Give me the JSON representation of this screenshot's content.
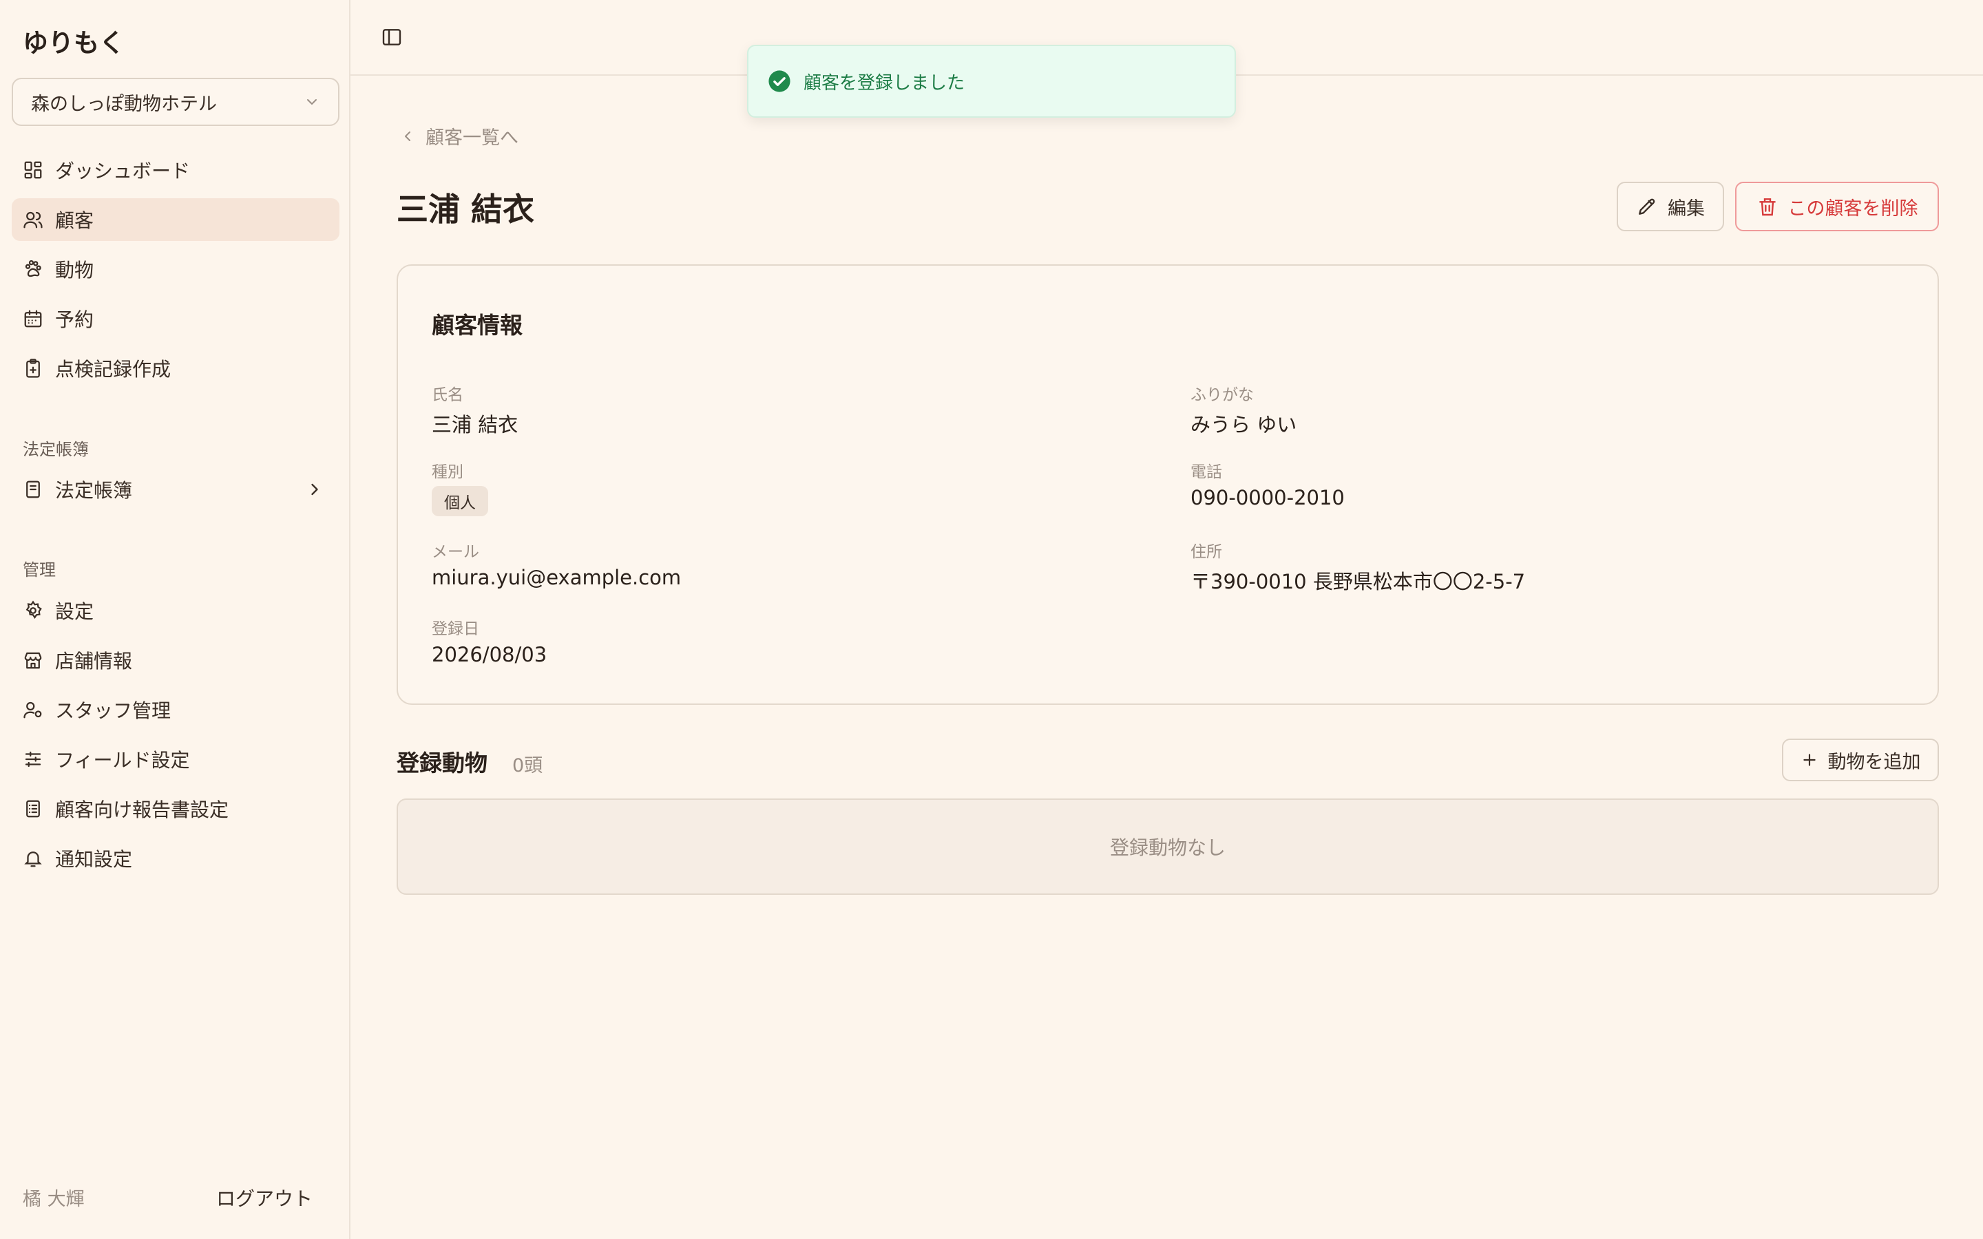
{
  "app": {
    "title": "ゆりもく"
  },
  "store": {
    "selected": "森のしっぽ動物ホテル"
  },
  "sidebar": {
    "main_items": [
      {
        "label": "ダッシュボード",
        "icon": "dashboard-icon"
      },
      {
        "label": "顧客",
        "icon": "users-icon",
        "active": true
      },
      {
        "label": "動物",
        "icon": "paw-icon"
      },
      {
        "label": "予約",
        "icon": "calendar-icon"
      },
      {
        "label": "点検記録作成",
        "icon": "clipboard-plus-icon"
      }
    ],
    "legal_section": "法定帳簿",
    "legal_items": [
      {
        "label": "法定帳簿",
        "icon": "book-icon"
      }
    ],
    "admin_section": "管理",
    "admin_items": [
      {
        "label": "設定",
        "icon": "gear-icon"
      },
      {
        "label": "店舗情報",
        "icon": "store-icon"
      },
      {
        "label": "スタッフ管理",
        "icon": "user-cog-icon"
      },
      {
        "label": "フィールド設定",
        "icon": "sliders-icon"
      },
      {
        "label": "顧客向け報告書設定",
        "icon": "report-icon"
      },
      {
        "label": "通知設定",
        "icon": "bell-icon"
      }
    ],
    "user_name": "橘 大輝",
    "logout_label": "ログアウト"
  },
  "toast": {
    "message": "顧客を登録しました",
    "color": "#1c7c45"
  },
  "breadcrumb": {
    "back_label": "顧客一覧へ"
  },
  "customer": {
    "title": "三浦 結衣",
    "edit_label": "編集",
    "delete_label": "この顧客を削除",
    "card_title": "顧客情報",
    "fields": {
      "name_label": "氏名",
      "name": "三浦 結衣",
      "furigana_label": "ふりがな",
      "furigana": "みうら ゆい",
      "type_label": "種別",
      "type": "個人",
      "phone_label": "電話",
      "phone": "090-0000-2010",
      "email_label": "メール",
      "email": "miura.yui@example.com",
      "address_label": "住所",
      "address": "〒390-0010 長野県松本市〇〇2-5-7",
      "registered_label": "登録日",
      "registered": "2026/08/03"
    }
  },
  "animals": {
    "title": "登録動物",
    "count": "0頭",
    "add_label": "動物を追加",
    "empty_label": "登録動物なし"
  },
  "colors": {
    "background": "#fdf5ec",
    "active_nav": "#f6e4d7",
    "danger": "#d63a3a",
    "success": "#1c7c45"
  }
}
